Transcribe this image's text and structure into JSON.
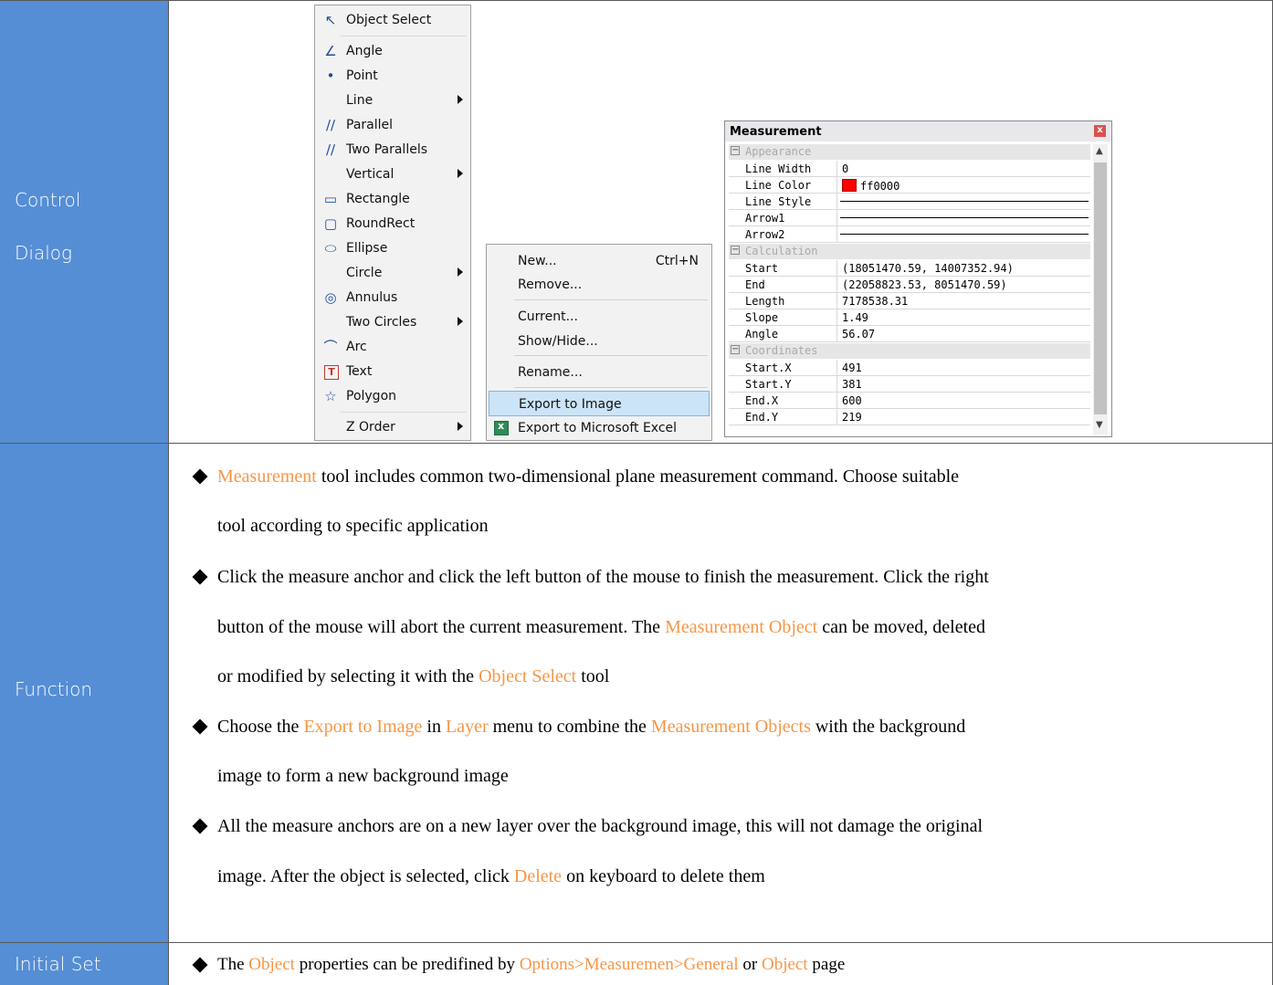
{
  "rows": {
    "control": {
      "label_line1": "Control",
      "label_line2": "Dialog"
    },
    "function": {
      "label": "Function"
    },
    "initial": {
      "label": "Initial Set"
    }
  },
  "menu1": {
    "items": [
      {
        "label": "Object Select",
        "icon": "cursor-arrow-icon"
      },
      {
        "label": "Angle",
        "icon": "angle-icon"
      },
      {
        "label": "Point",
        "icon": "point-icon"
      },
      {
        "label": "Line",
        "icon": "",
        "submenu": true
      },
      {
        "label": "Parallel",
        "icon": "parallel-icon"
      },
      {
        "label": "Two Parallels",
        "icon": "two-parallels-icon"
      },
      {
        "label": "Vertical",
        "icon": "",
        "submenu": true
      },
      {
        "label": "Rectangle",
        "icon": "rectangle-icon"
      },
      {
        "label": "RoundRect",
        "icon": "roundrect-icon"
      },
      {
        "label": "Ellipse",
        "icon": "ellipse-icon"
      },
      {
        "label": "Circle",
        "icon": "",
        "submenu": true
      },
      {
        "label": "Annulus",
        "icon": "annulus-icon"
      },
      {
        "label": "Two Circles",
        "icon": "",
        "submenu": true
      },
      {
        "label": "Arc",
        "icon": "arc-icon"
      },
      {
        "label": "Text",
        "icon": "text-icon"
      },
      {
        "label": "Polygon",
        "icon": "polygon-icon"
      },
      {
        "label": "Z Order",
        "icon": "",
        "submenu": true
      }
    ]
  },
  "menu2": {
    "items": [
      {
        "label": "New...",
        "shortcut": "Ctrl+N"
      },
      {
        "label": "Remove..."
      },
      {
        "label": "Current..."
      },
      {
        "label": "Show/Hide..."
      },
      {
        "label": "Rename..."
      },
      {
        "label": "Export to Image"
      },
      {
        "label": "Export to Microsoft Excel",
        "icon": "excel-icon"
      }
    ]
  },
  "dialog": {
    "title": "Measurement",
    "close_glyph": "x",
    "categories": {
      "appearance": "Appearance",
      "calculation": "Calculation",
      "coordinates": "Coordinates"
    },
    "appearance": {
      "line_width": {
        "name": "Line Width",
        "value": "0"
      },
      "line_color": {
        "name": "Line Color",
        "value": "ff0000",
        "color": "#ff0000"
      },
      "line_style": {
        "name": "Line Style"
      },
      "arrow1": {
        "name": "Arrow1"
      },
      "arrow2": {
        "name": "Arrow2"
      }
    },
    "calculation": {
      "start": {
        "name": "Start",
        "value": "(18051470.59, 14007352.94)"
      },
      "end": {
        "name": "End",
        "value": "(22058823.53, 8051470.59)"
      },
      "length": {
        "name": "Length",
        "value": "7178538.31"
      },
      "slope": {
        "name": "Slope",
        "value": "1.49"
      },
      "angle": {
        "name": "Angle",
        "value": "56.07"
      }
    },
    "coordinates": {
      "start_x": {
        "name": "Start.X",
        "value": "491"
      },
      "start_y": {
        "name": "Start.Y",
        "value": "381"
      },
      "end_x": {
        "name": "End.X",
        "value": "600"
      },
      "end_y": {
        "name": "End.Y",
        "value": "219"
      }
    }
  },
  "function_text": {
    "b1_l1_hl": "Measurement",
    "b1_l1": " tool includes common two-dimensional plane measurement command. Choose suitable",
    "b1_l2": "tool according to specific application",
    "b2_l1": "Click the measure anchor and click the left button of the mouse to finish the measurement. Click the right",
    "b2_l2a": "button of the mouse will abort the current measurement. The ",
    "b2_l2_hl": "Measurement Object",
    "b2_l2b": " can be moved, deleted",
    "b2_l3a": "or modified by selecting it with the ",
    "b2_l3_hl": "Object Select",
    "b2_l3b": " tool",
    "b3_l1a": "Choose the ",
    "b3_l1_hl1": "Export to Image",
    "b3_l1b": " in ",
    "b3_l1_hl2": "Layer",
    "b3_l1c": " menu to combine the ",
    "b3_l1_hl3": "Measurement Objects",
    "b3_l1d": " with the background",
    "b3_l2": "image to form a new background image",
    "b4_l1": "All the measure anchors are on a new layer over the background image, this will not damage the original",
    "b4_l2a": "image. After the object is selected, click ",
    "b4_l2_hl": "Delete",
    "b4_l2b": " on keyboard to delete them"
  },
  "initial_text": {
    "a": "The ",
    "hl1": "Object",
    "b": " properties can be predifined by ",
    "hl2": "Options>Measuremen>General",
    "c": " or ",
    "hl3": "Object",
    "d": " page"
  },
  "colors": {
    "label_bg": "#558ed5",
    "highlight": "#f79646"
  }
}
